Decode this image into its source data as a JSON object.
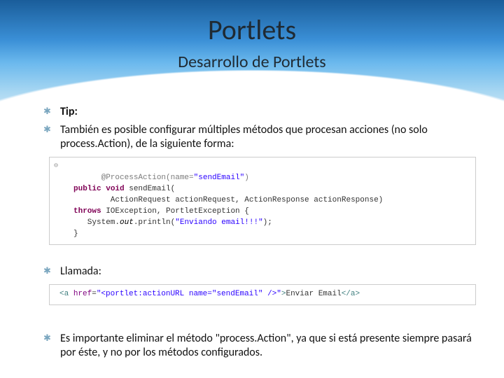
{
  "title": "Portlets",
  "subtitle": "Desarrollo de Portlets",
  "bullets": {
    "tip": "Tip:",
    "intro": "También es posible configurar múltiples métodos que procesan acciones (no solo process.Action), de la siguiente forma:",
    "llamada": "Llamada:",
    "note": "Es importante eliminar el método \"process.Action\", ya que si está presente siempre pasará por éste, y no por los métodos configurados."
  },
  "code1": {
    "l1a": "@ProcessAction(name=",
    "l1b": "\"sendEmail\"",
    "l1c": ")",
    "l2a": "public",
    "l2b": " ",
    "l2c": "void",
    "l2d": " sendEmail(",
    "l3": "        ActionRequest actionRequest, ActionResponse actionResponse)",
    "l4a": "throws",
    "l4b": " IOException, PortletException {",
    "l5a": "   System.",
    "l5b": "out",
    "l5c": ".println(",
    "l5d": "\"Enviando email!!!\"",
    "l5e": ");",
    "l6": "}"
  },
  "code2": {
    "p1": "<a ",
    "p2": "href",
    "p3": "=",
    "p4": "\"<portlet:actionURL name=\"sendEmail\" />\"",
    "p5": ">",
    "p6": "Enviar Email",
    "p7": "</a>"
  }
}
